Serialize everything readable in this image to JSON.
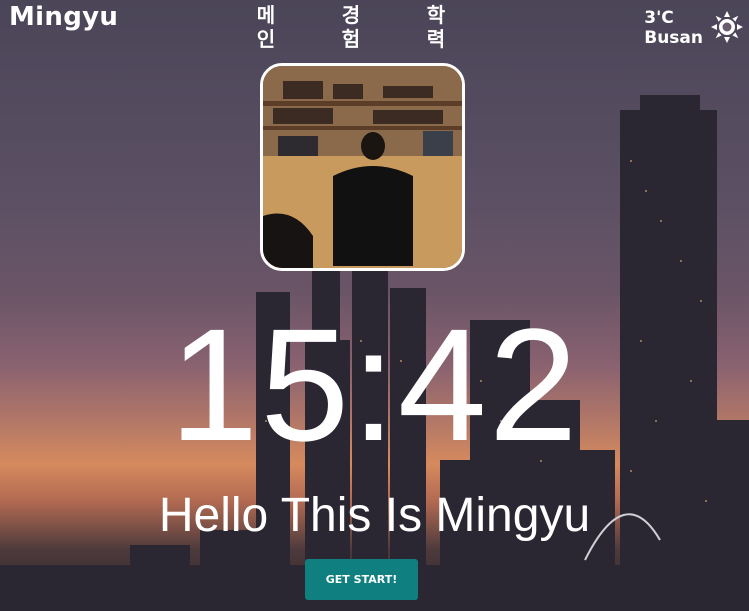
{
  "brand": "Mingyu",
  "nav": [
    {
      "top": "메",
      "bottom": "인"
    },
    {
      "top": "경",
      "bottom": "험"
    },
    {
      "top": "학",
      "bottom": "력"
    }
  ],
  "weather": {
    "temp": "3'C",
    "city": "Busan",
    "icon": "sun-icon"
  },
  "clock": "15:42",
  "greeting": "Hello This Is Mingyu",
  "cta": "GET START!",
  "colors": {
    "button": "#0f7f80",
    "text": "#ffffff"
  }
}
